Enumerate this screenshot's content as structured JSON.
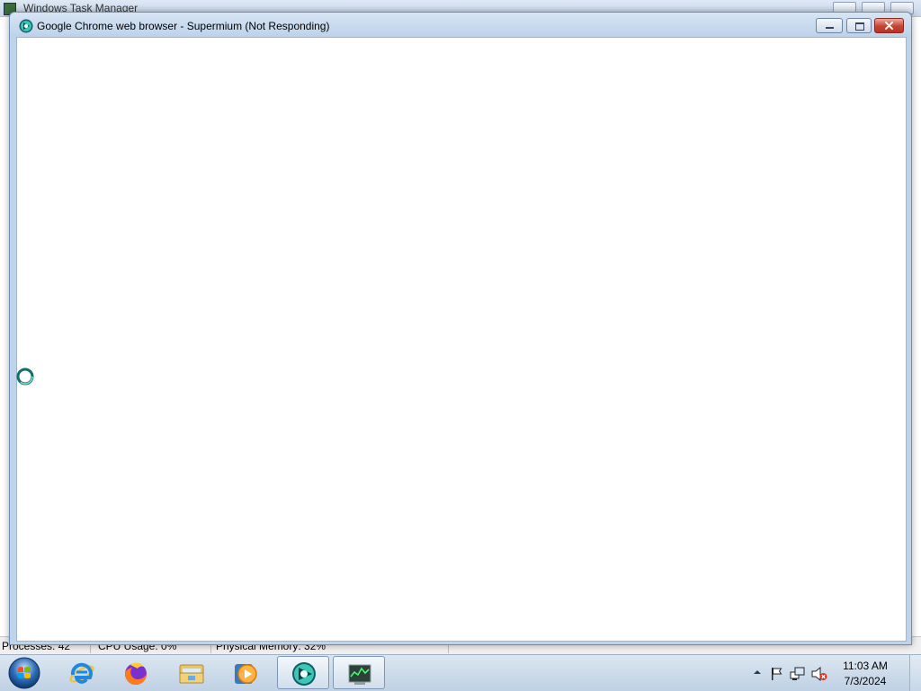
{
  "background_window": {
    "title": "Windows Task Manager",
    "status": {
      "processes": "Processes: 42",
      "cpu": "CPU Usage: 0%",
      "memory": "Physical Memory: 32%"
    }
  },
  "window": {
    "title": "Google Chrome web browser - Supermium (Not Responding)",
    "app_icon": "supermium-icon",
    "controls": [
      "minimize-icon",
      "maximize-icon",
      "close-icon"
    ]
  },
  "cursor": "busy-cursor-icon",
  "taskbar": {
    "start": "windows-start-orb-icon",
    "pinned": [
      {
        "name": "internet-explorer-icon",
        "active": false
      },
      {
        "name": "firefox-icon",
        "active": false
      },
      {
        "name": "file-explorer-icon",
        "active": false
      },
      {
        "name": "media-player-icon",
        "active": false
      },
      {
        "name": "supermium-icon",
        "active": true
      },
      {
        "name": "task-manager-icon",
        "active": true
      }
    ],
    "tray": {
      "icons": [
        "show-hidden-icons-icon",
        "action-center-flag-icon",
        "network-icon",
        "volume-muted-icon"
      ],
      "time": "11:03 AM",
      "date": "7/3/2024"
    }
  }
}
